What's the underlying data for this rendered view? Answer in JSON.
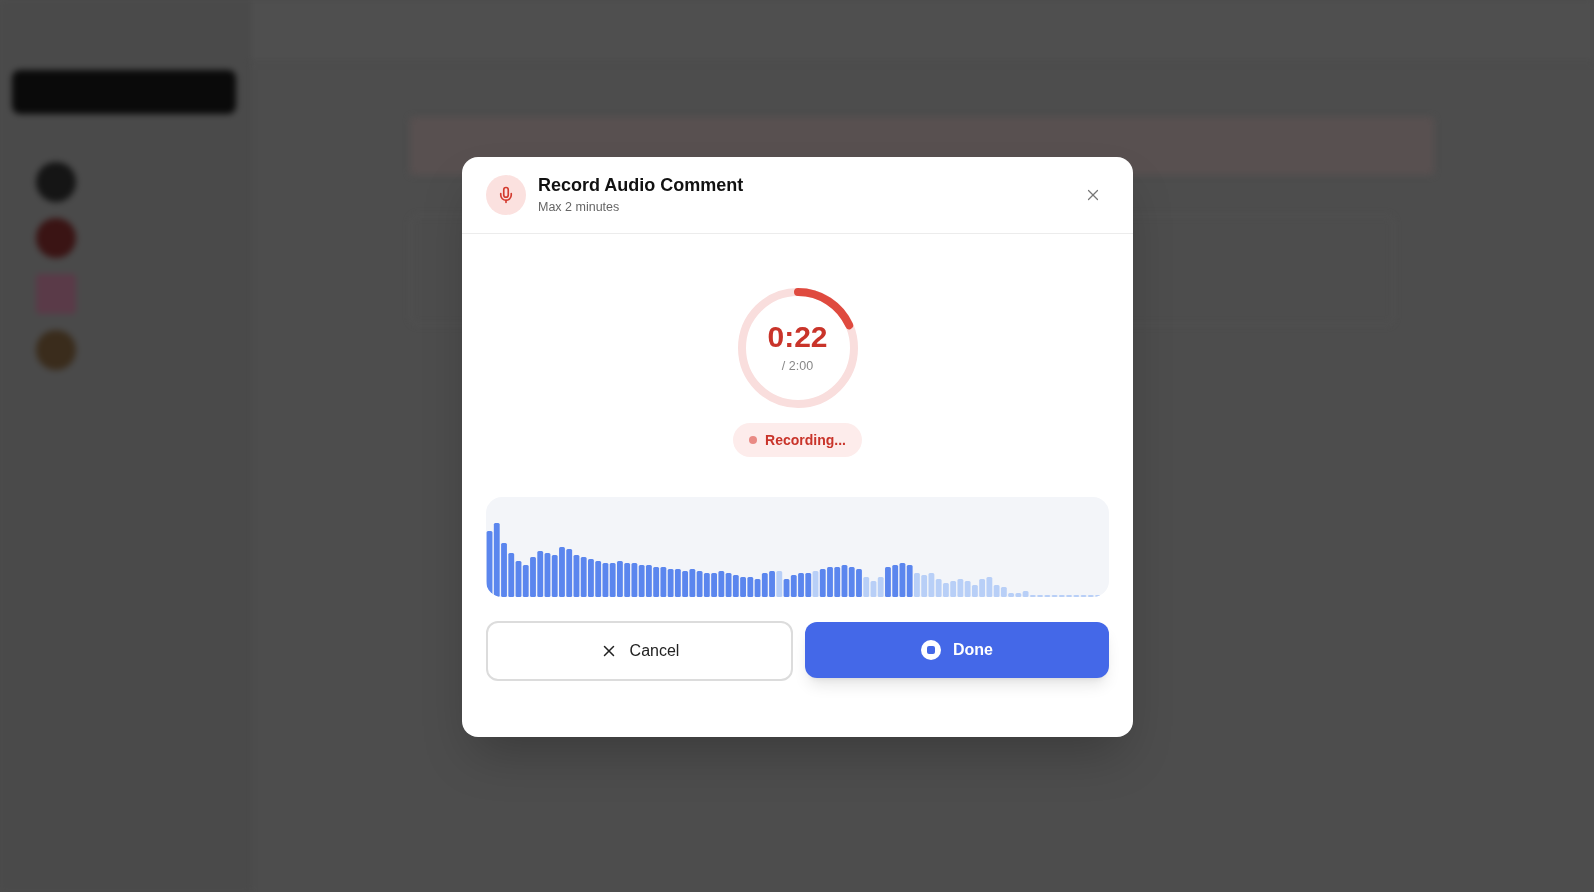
{
  "dialog": {
    "title": "Record Audio Comment",
    "subtitle": "Max 2 minutes",
    "timer": {
      "elapsed": "0:22",
      "total": "/ 2:00",
      "level": 0.183
    },
    "status": {
      "label": "Recording...",
      "recording": true
    },
    "buttons": [
      {
        "kind": "cancel",
        "label": "Cancel"
      },
      {
        "kind": "done",
        "label": "Done"
      }
    ]
  }
}
